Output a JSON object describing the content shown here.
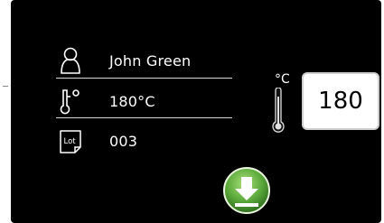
{
  "form": {
    "user_name": "John Green",
    "temperature_display": "180°C",
    "lot_label": "Lot",
    "lot_number": "003"
  },
  "temperature_control": {
    "unit": "°C",
    "value": "180"
  },
  "icons": {
    "user": "user-outline-icon",
    "temperature": "thermometer-icon",
    "lot": "lot-tag-icon",
    "download": "download-arrow-icon"
  },
  "colors": {
    "background": "#000000",
    "text": "#ffffff",
    "accent_green": "#5aa83a"
  }
}
